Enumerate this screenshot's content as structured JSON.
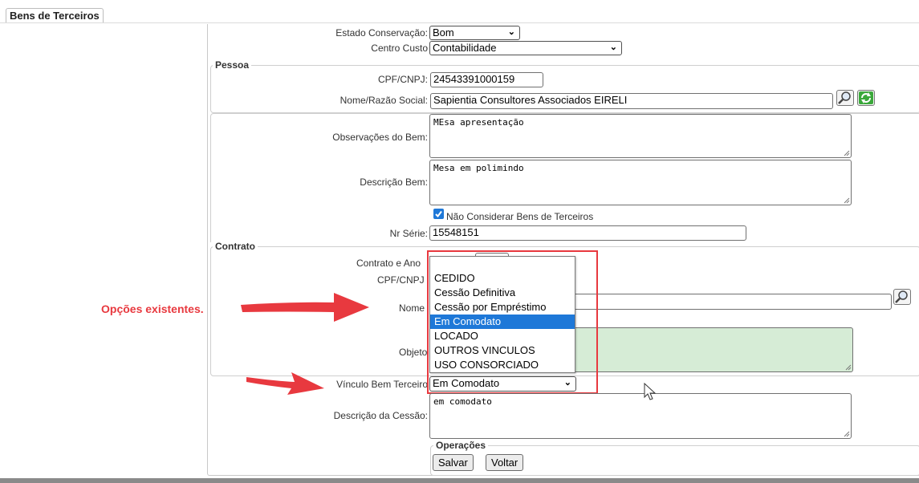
{
  "tab": {
    "title": "Bens de Terceiros"
  },
  "form": {
    "estado_conservacao": {
      "label": "Estado Conservação:",
      "value": "Bom"
    },
    "centro_custo": {
      "label": "Centro Custo",
      "value": "Contabilidade"
    },
    "pessoa": {
      "legend": "Pessoa",
      "cpf_cnpj": {
        "label": "CPF/CNPJ:",
        "value": "24543391000159"
      },
      "nome": {
        "label": "Nome/Razão Social:",
        "value": "Sapientia Consultores Associados EIRELI"
      }
    },
    "observacoes": {
      "label": "Observações do Bem:",
      "value": "MEsa apresentação"
    },
    "descricao_bem": {
      "label": "Descrição Bem:",
      "value": "Mesa em polimindo"
    },
    "nao_considerar": {
      "label": "Não Considerar Bens de Terceiros",
      "checked": true
    },
    "nr_serie": {
      "label": "Nr Série:",
      "value": "15548151"
    },
    "contrato": {
      "legend": "Contrato",
      "contrato_ano": {
        "label": "Contrato e Ano"
      },
      "cpf_cnpj": {
        "label": "CPF/CNPJ"
      },
      "nome": {
        "label": "Nome"
      },
      "objeto": {
        "label": "Objeto"
      }
    },
    "vinculo": {
      "label": "Vínculo Bem Terceiro",
      "value": "Em Comodato",
      "options": [
        "CEDIDO",
        "Cessão Definitiva",
        "Cessão por Empréstimo",
        "Em Comodato",
        "LOCADO",
        "OUTROS VINCULOS",
        "USO CONSORCIADO"
      ],
      "highlighted_index": 3
    },
    "descricao_cessao": {
      "label": "Descrição da Cessão:",
      "value": "em comodato"
    },
    "operacoes": {
      "legend": "Operações",
      "salvar": "Salvar",
      "voltar": "Voltar"
    }
  },
  "annotation": {
    "text": "Opções existentes.",
    "color": "#e8393f"
  },
  "colors": {
    "highlight": "#1e78d8",
    "annotation": "#e8393f",
    "textarea_green": "#d6ecd6"
  }
}
